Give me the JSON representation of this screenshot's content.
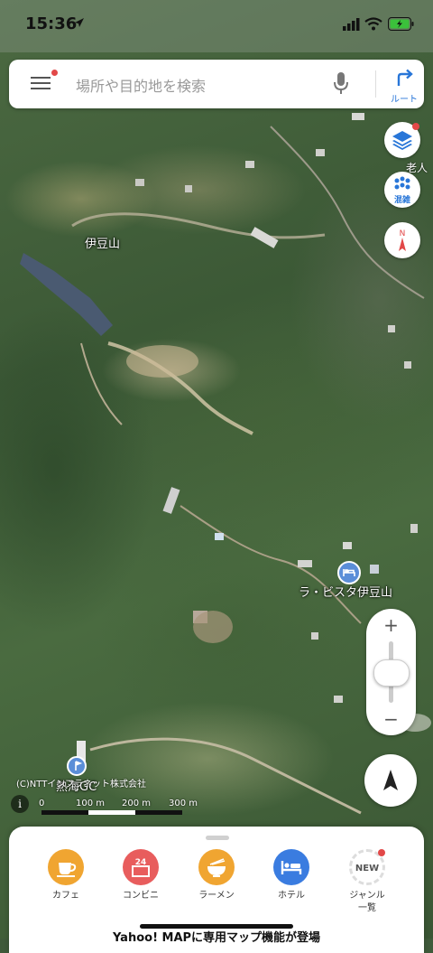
{
  "status_bar": {
    "time": "15:36"
  },
  "search": {
    "placeholder": "場所や目的地を検索",
    "route_label": "ルート"
  },
  "side_buttons": {
    "congestion_label": "混雑",
    "compass_letter": "N"
  },
  "map_labels": {
    "area": "伊豆山",
    "hotel": "ラ・ビスタ伊豆山",
    "golf": "熱海GC",
    "edge_text": "マ\n老人\nウ"
  },
  "zoom": {
    "plus": "+",
    "minus": "−"
  },
  "attribution": "(C)NTTインフラネット株式会社",
  "scale": {
    "labels": [
      "0",
      "100 m",
      "200 m",
      "300 m"
    ]
  },
  "categories": [
    {
      "label": "カフェ",
      "icon": "coffee-cup-icon",
      "color": "#f0a531"
    },
    {
      "label": "コンビニ",
      "icon": "convenience-store-icon",
      "color": "#e85d5d"
    },
    {
      "label": "ラーメン",
      "icon": "ramen-bowl-icon",
      "color": "#f0a531"
    },
    {
      "label": "ホテル",
      "icon": "bed-icon",
      "color": "#3a7ce0"
    },
    {
      "label": "ジャンル\n一覧",
      "icon": "new-badge-icon",
      "color": "#ffffff"
    }
  ],
  "badges": {
    "convenience_number": "24",
    "new_text": "NEW"
  },
  "promo": "Yahoo! MAPに専用マップ機能が登場",
  "colors": {
    "accent_blue": "#2876d8",
    "alert_red": "#e24848"
  }
}
